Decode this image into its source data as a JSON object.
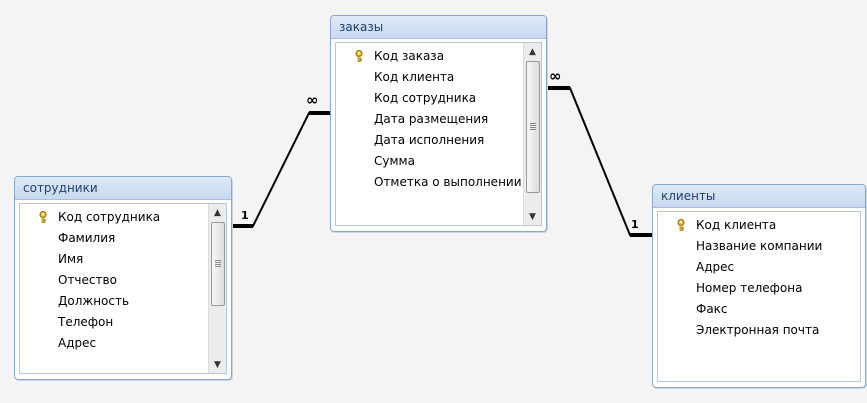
{
  "tables": {
    "employees": {
      "title": "сотрудники",
      "fields": [
        "Код сотрудника",
        "Фамилия",
        "Имя",
        "Отчество",
        "Должность",
        "Телефон",
        "Адрес"
      ],
      "primary_key_index": 0
    },
    "orders": {
      "title": "заказы",
      "fields": [
        "Код заказа",
        "Код клиента",
        "Код сотрудника",
        "Дата размещения",
        "Дата исполнения",
        "Сумма",
        "Отметка о выполнении"
      ],
      "primary_key_index": 0
    },
    "clients": {
      "title": "клиенты",
      "fields": [
        "Код клиента",
        "Название компании",
        "Адрес",
        "Номер телефона",
        "Факс",
        "Электронная почта"
      ],
      "primary_key_index": 0
    }
  },
  "relationships": {
    "employees_orders": {
      "one_label": "1",
      "many_label": "∞"
    },
    "clients_orders": {
      "one_label": "1",
      "many_label": "∞"
    }
  },
  "icons": {
    "primary_key": "key-icon",
    "scroll_up": "arrow-up-icon",
    "scroll_down": "arrow-down-icon"
  },
  "colors": {
    "title_bar": "#c6d8f0",
    "title_text": "#1f3f6e",
    "border": "#8aa8cf",
    "relationship_line": "#000000"
  }
}
